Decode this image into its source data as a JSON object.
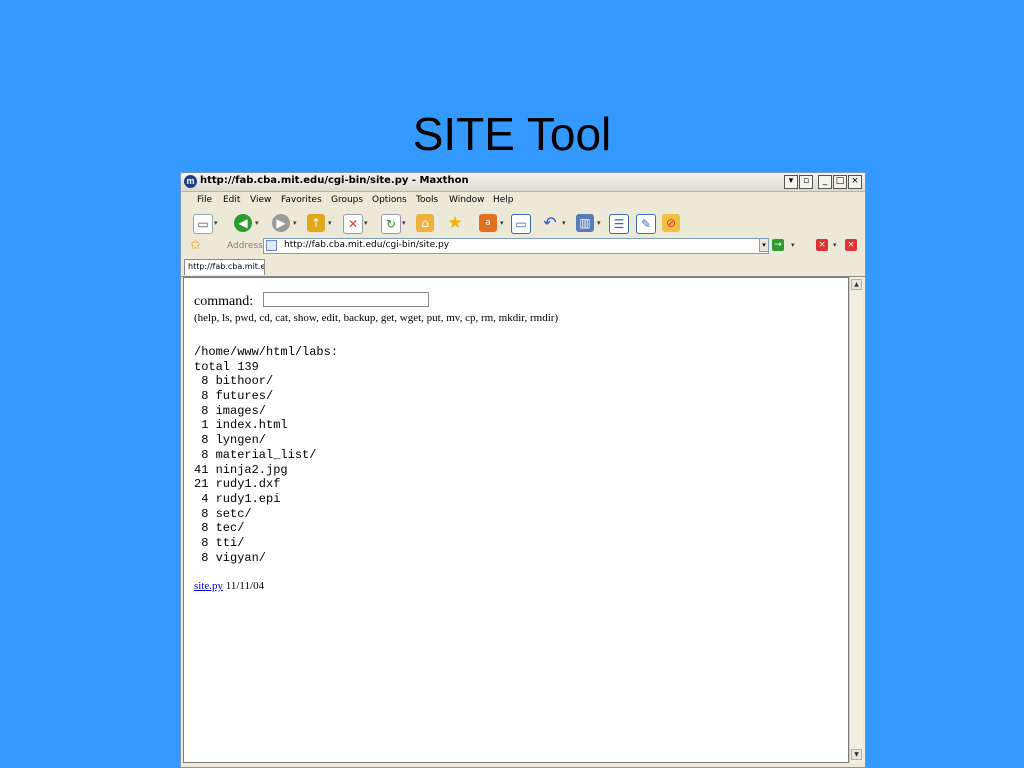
{
  "slide": {
    "title": "SITE Tool"
  },
  "window": {
    "title": "http://fab.cba.mit.edu/cgi-bin/site.py - Maxthon",
    "app_icon": "m"
  },
  "menu": [
    {
      "label": "File"
    },
    {
      "label": "Edit"
    },
    {
      "label": "View"
    },
    {
      "label": "Favorites"
    },
    {
      "label": "Groups"
    },
    {
      "label": "Options"
    },
    {
      "label": "Tools"
    },
    {
      "label": "Window"
    },
    {
      "label": "Help"
    }
  ],
  "address": {
    "label": "Address",
    "url": "http://fab.cba.mit.edu/cgi-bin/site.py"
  },
  "tab": {
    "label": "http://fab.cba.mit.e"
  },
  "page": {
    "command_label": "command",
    "command_value": "",
    "help": "(help, ls, pwd, cd, cat, show, edit, backup, get, wget, put, mv, cp, rm, mkdir, rmdir)",
    "listing": [
      "/home/www/html/labs:",
      "total 139",
      " 8 bithoor/",
      " 8 futures/",
      " 8 images/",
      " 1 index.html",
      " 8 lyngen/",
      " 8 material_list/",
      "41 ninja2.jpg",
      "21 rudy1.dxf",
      " 4 rudy1.epi",
      " 8 setc/",
      " 8 tec/",
      " 8 tti/",
      " 8 vigyan/"
    ],
    "footer_link": "site.py",
    "footer_date": "11/11/04"
  },
  "colors": {
    "slide_background": "#3399ff",
    "link": "#0000cc"
  }
}
